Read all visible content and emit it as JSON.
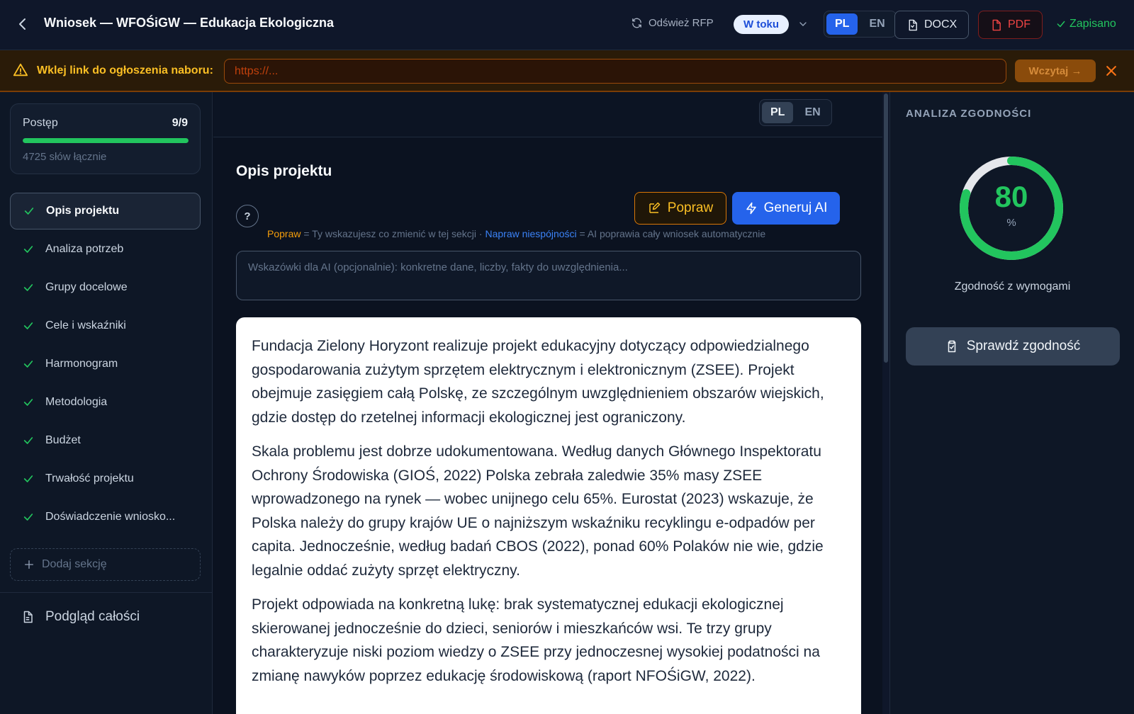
{
  "header": {
    "title": "Wniosek — WFOŚiGW — Edukacja Ekologiczna",
    "refresh_label": "Odśwież RFP",
    "status_label": "W toku",
    "lang_options": [
      "PL",
      "EN"
    ],
    "lang_active": "PL",
    "docx_label": "DOCX",
    "pdf_label": "PDF",
    "saved_label": "Zapisano",
    "icons": [
      "back-arrow-icon",
      "refresh-icon",
      "chevron-down-icon",
      "document-icon",
      "pdf-file-icon",
      "check-icon"
    ]
  },
  "url_bar": {
    "label": "Wklej link do ogłoszenia naboru:",
    "placeholder": "https://...",
    "load_label": "Wczytaj →",
    "icons": [
      "warning-icon",
      "close-icon"
    ]
  },
  "sidebar": {
    "progress_label": "Postęp",
    "progress_count": "9/9",
    "progress_fraction": 1.0,
    "words_total": "4725 słów łącznie",
    "items": [
      {
        "label": "Opis projektu",
        "active": true
      },
      {
        "label": "Analiza potrzeb",
        "active": false
      },
      {
        "label": "Grupy docelowe",
        "active": false
      },
      {
        "label": "Cele i wskaźniki",
        "active": false
      },
      {
        "label": "Harmonogram",
        "active": false
      },
      {
        "label": "Metodologia",
        "active": false
      },
      {
        "label": "Budżet",
        "active": false
      },
      {
        "label": "Trwałość projektu",
        "active": false
      },
      {
        "label": "Doświadczenie wniosko...",
        "active": false
      }
    ],
    "add_section_label": "Dodaj sekcję",
    "preview_label": "Podgląd całości"
  },
  "main": {
    "lang_options": [
      "PL",
      "EN"
    ],
    "lang_active": "PL",
    "section_title": "Opis projektu",
    "help_label": "?",
    "fix_label": "Popraw",
    "generate_label": "Generuj AI",
    "hint": {
      "fix_term": "Popraw",
      "fix_desc": " = Ty wskazujesz co zmienić w tej sekcji",
      "separator": " · ",
      "repair_term": "Napraw niespójności",
      "repair_desc": " = AI poprawia cały wniosek automatycznie"
    },
    "ai_hint_placeholder": "Wskazówki dla AI (opcjonalnie): konkretne dane, liczby, fakty do uwzględnienia...",
    "paragraphs": [
      "Fundacja Zielony Horyzont realizuje projekt edukacyjny dotyczący odpowiedzialnego gospodarowania zużytym sprzętem elektrycznym i elektronicznym (ZSEE). Projekt obejmuje zasięgiem całą Polskę, ze szczególnym uwzględnieniem obszarów wiejskich, gdzie dostęp do rzetelnej informacji ekologicznej jest ograniczony.",
      "Skala problemu jest dobrze udokumentowana. Według danych Głównego Inspektoratu Ochrony Środowiska (GIOŚ, 2022) Polska zebrała zaledwie 35% masy ZSEE wprowadzonego na rynek — wobec unijnego celu 65%. Eurostat (2023) wskazuje, że Polska należy do grupy krajów UE o najniższym wskaźniku recyklingu e-odpadów per capita. Jednocześnie, według badań CBOS (2022), ponad 60% Polaków nie wie, gdzie legalnie oddać zużyty sprzęt elektryczny.",
      "Projekt odpowiada na konkretną lukę: brak systematycznej edukacji ekologicznej skierowanej jednocześnie do dzieci, seniorów i mieszkańców wsi. Te trzy grupy charakteryzuje niski poziom wiedzy o ZSEE przy jednoczesnej wysokiej podatności na zmianę nawyków poprzez edukację środowiskową (raport NFOŚiGW, 2022)."
    ]
  },
  "compliance": {
    "title": "ANALIZA ZGODNOŚCI",
    "score": "80",
    "score_fraction": 0.8,
    "unit": "%",
    "caption": "Zgodność z wymogami",
    "check_label": "Sprawdź zgodność",
    "colors": {
      "ring": "#22c55e",
      "track": "#e5e7eb"
    }
  }
}
